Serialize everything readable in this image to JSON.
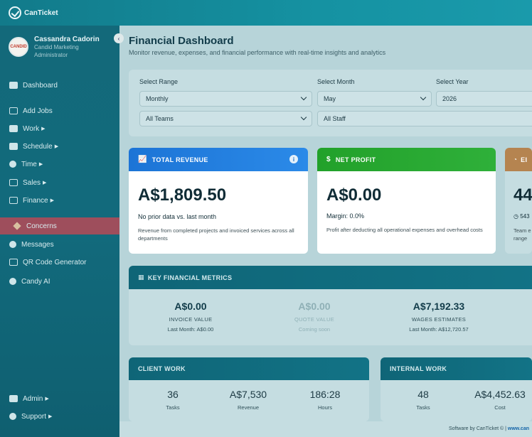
{
  "app": {
    "brand": "CanTicket"
  },
  "profile": {
    "name": "Cassandra Cadorin",
    "org": "Candid Marketing",
    "role": "Administrator",
    "avatar_text": "CANDID"
  },
  "sidebar": {
    "items": [
      {
        "label": "Dashboard",
        "icon": "home-icon"
      },
      {
        "label": "Add Jobs",
        "icon": "add-job-icon"
      },
      {
        "label": "Work",
        "icon": "briefcase-icon",
        "caret": "▶"
      },
      {
        "label": "Schedule",
        "icon": "calendar-icon",
        "caret": "▶"
      },
      {
        "label": "Time",
        "icon": "clock-icon",
        "caret": "▶"
      },
      {
        "label": "Sales",
        "icon": "sales-icon",
        "caret": "▶"
      },
      {
        "label": "Finance",
        "icon": "finance-icon",
        "caret": "▶"
      },
      {
        "label": "Concerns",
        "icon": "concerns-icon",
        "active": true
      },
      {
        "label": "Messages",
        "icon": "chat-icon"
      },
      {
        "label": "QR Code Generator",
        "icon": "qr-code-icon"
      },
      {
        "label": "Candy AI",
        "icon": "ai-avatar-icon"
      },
      {
        "label": "Admin",
        "icon": "shield-icon",
        "caret": "▶"
      },
      {
        "label": "Support",
        "icon": "headset-icon",
        "caret": "▶"
      }
    ]
  },
  "header": {
    "title": "Financial Dashboard",
    "subtitle": "Monitor revenue, expenses, and financial performance with real-time insights and analytics"
  },
  "filters": {
    "range_label": "Select Range",
    "range_value": "Monthly",
    "month_label": "Select Month",
    "month_value": "May",
    "year_label": "Select Year",
    "year_value": "2026",
    "team_value": "All Teams",
    "staff_value": "All Staff"
  },
  "cards": {
    "revenue": {
      "title": "TOTAL REVENUE",
      "value": "A$1,809.50",
      "comparison": "No prior data  vs. last month",
      "description": "Revenue from completed projects and invoiced services across all departments",
      "color": "#1e7fe0"
    },
    "profit": {
      "title": "NET PROFIT",
      "value": "A$0.00",
      "margin": "Margin: 0.0%",
      "description": "Profit after deducting all operational expenses and overhead costs",
      "color": "#27a52b"
    },
    "third": {
      "title": "EI",
      "value": "44",
      "line": "543",
      "desc_line1": "Team e",
      "desc_line2": "range",
      "color": "#c58a4a"
    }
  },
  "metrics": {
    "title": "KEY FINANCIAL METRICS",
    "items": [
      {
        "value": "A$0.00",
        "label": "INVOICE VALUE",
        "sub": "Last Month: A$0.00"
      },
      {
        "value": "A$0.00",
        "label": "QUOTE VALUE",
        "sub": "Coming soon"
      },
      {
        "value": "A$7,192.33",
        "label": "WAGES ESTIMATES",
        "sub": "Last Month: A$12,720.57"
      }
    ]
  },
  "client_work": {
    "title": "CLIENT WORK",
    "stats": [
      {
        "value": "36",
        "label": "Tasks"
      },
      {
        "value": "A$7,530",
        "label": "Revenue"
      },
      {
        "value": "186:28",
        "label": "Hours"
      }
    ]
  },
  "internal_work": {
    "title": "INTERNAL WORK",
    "stats": [
      {
        "value": "48",
        "label": "Tasks"
      },
      {
        "value": "A$4,452.63",
        "label": "Cost"
      }
    ]
  },
  "footer": {
    "text": "Software by CanTicket © | ",
    "link": "www.can"
  }
}
